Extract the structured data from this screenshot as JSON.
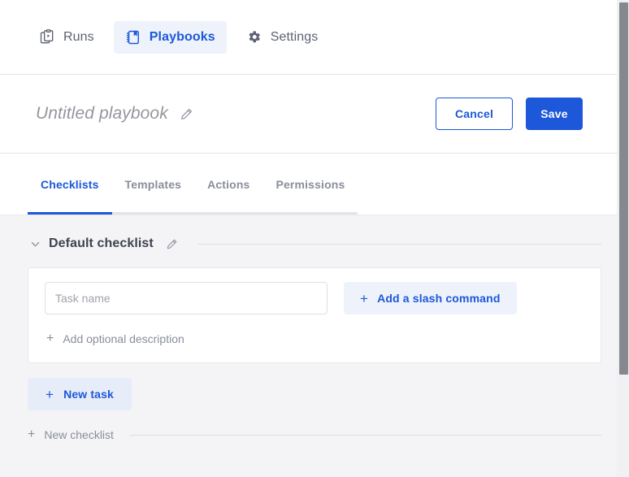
{
  "nav": {
    "items": [
      {
        "label": "Runs",
        "icon": "clipboard-play-icon",
        "active": false
      },
      {
        "label": "Playbooks",
        "icon": "playbook-book-icon",
        "active": true
      },
      {
        "label": "Settings",
        "icon": "gear-icon",
        "active": false
      }
    ]
  },
  "header": {
    "title": "Untitled playbook",
    "edit_icon": "pencil-icon",
    "cancel_label": "Cancel",
    "save_label": "Save"
  },
  "tabs": [
    {
      "label": "Checklists",
      "active": true
    },
    {
      "label": "Templates",
      "active": false
    },
    {
      "label": "Actions",
      "active": false
    },
    {
      "label": "Permissions",
      "active": false
    }
  ],
  "checklist": {
    "collapse_icon": "chevron-down-icon",
    "title": "Default checklist",
    "edit_icon": "pencil-icon",
    "task": {
      "name_value": "",
      "name_placeholder": "Task name",
      "slash_command_label": "Add a slash command",
      "add_description_label": "Add optional description",
      "plus_glyph": "+"
    },
    "new_task_label": "New task",
    "new_checklist_label": "New checklist"
  },
  "colors": {
    "accent_blue": "#1c58d9",
    "accent_blue_soft": "#eef2fb",
    "page_bg": "#f4f4f6",
    "text_primary": "#3f4350",
    "text_muted": "#8a8e9c",
    "border": "#e4e5e8"
  }
}
